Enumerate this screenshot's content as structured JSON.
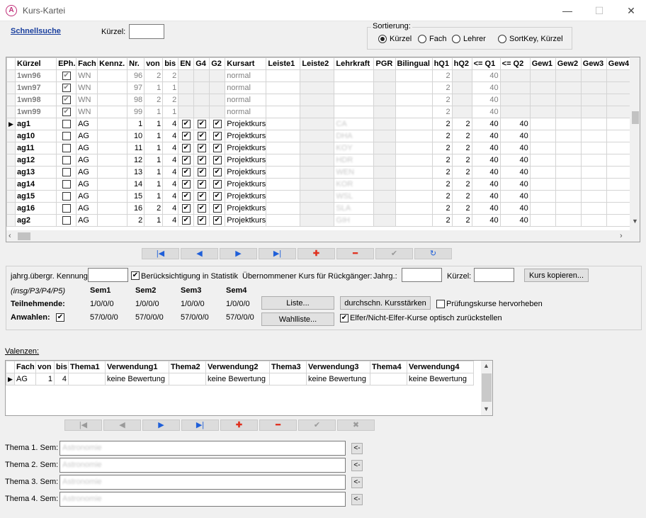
{
  "window": {
    "title": "Kurs-Kartei",
    "minimize": "—",
    "maximize": "☐",
    "close": "✕"
  },
  "quicksearch": {
    "link": "Schnellsuche",
    "kuerzel_label": "Kürzel:",
    "kuerzel_value": ""
  },
  "sort": {
    "title": "Sortierung:",
    "options": [
      "Kürzel",
      "Fach",
      "Lehrer",
      "SortKey, Kürzel"
    ],
    "selected": 0
  },
  "grid": {
    "columns": [
      "Kürzel",
      "EPh.",
      "Fach",
      "Kennz.",
      "Nr.",
      "von",
      "bis",
      "EN",
      "G4",
      "G2",
      "Kursart",
      "Leiste1",
      "Leiste2",
      "Lehrkraft",
      "PGR",
      "Bilingual",
      "hQ1",
      "hQ2",
      "<= Q1",
      "<= Q2",
      "Gew1",
      "Gew2",
      "Gew3",
      "Gew4"
    ],
    "rows": [
      {
        "k": "1wn96",
        "eph": true,
        "fach": "WN",
        "nr": "96",
        "von": "2",
        "bis": "2",
        "en": false,
        "g4": false,
        "g2": false,
        "art": "normal",
        "lk": "",
        "hq1": "2",
        "hq2": "",
        "q1": "40",
        "q2": "",
        "grey": true
      },
      {
        "k": "1wn97",
        "eph": true,
        "fach": "WN",
        "nr": "97",
        "von": "1",
        "bis": "1",
        "en": false,
        "g4": false,
        "g2": false,
        "art": "normal",
        "lk": "",
        "hq1": "2",
        "hq2": "",
        "q1": "40",
        "q2": "",
        "grey": true
      },
      {
        "k": "1wn98",
        "eph": true,
        "fach": "WN",
        "nr": "98",
        "von": "2",
        "bis": "2",
        "en": false,
        "g4": false,
        "g2": false,
        "art": "normal",
        "lk": "",
        "hq1": "2",
        "hq2": "",
        "q1": "40",
        "q2": "",
        "grey": true
      },
      {
        "k": "1wn99",
        "eph": true,
        "fach": "WN",
        "nr": "99",
        "von": "1",
        "bis": "1",
        "en": false,
        "g4": false,
        "g2": false,
        "art": "normal",
        "lk": "",
        "hq1": "2",
        "hq2": "",
        "q1": "40",
        "q2": "",
        "grey": true
      },
      {
        "k": "ag1",
        "eph": false,
        "fach": "AG",
        "nr": "1",
        "von": "1",
        "bis": "4",
        "en": true,
        "g4": true,
        "g2": true,
        "art": "Projektkurs",
        "lk": "CA",
        "hq1": "2",
        "hq2": "2",
        "q1": "40",
        "q2": "40",
        "grey": false,
        "current": true
      },
      {
        "k": "ag10",
        "eph": false,
        "fach": "AG",
        "nr": "10",
        "von": "1",
        "bis": "4",
        "en": true,
        "g4": true,
        "g2": true,
        "art": "Projektkurs",
        "lk": "DHA",
        "hq1": "2",
        "hq2": "2",
        "q1": "40",
        "q2": "40",
        "grey": false
      },
      {
        "k": "ag11",
        "eph": false,
        "fach": "AG",
        "nr": "11",
        "von": "1",
        "bis": "4",
        "en": true,
        "g4": true,
        "g2": true,
        "art": "Projektkurs",
        "lk": "KOY",
        "hq1": "2",
        "hq2": "2",
        "q1": "40",
        "q2": "40",
        "grey": false
      },
      {
        "k": "ag12",
        "eph": false,
        "fach": "AG",
        "nr": "12",
        "von": "1",
        "bis": "4",
        "en": true,
        "g4": true,
        "g2": true,
        "art": "Projektkurs",
        "lk": "HDR",
        "hq1": "2",
        "hq2": "2",
        "q1": "40",
        "q2": "40",
        "grey": false
      },
      {
        "k": "ag13",
        "eph": false,
        "fach": "AG",
        "nr": "13",
        "von": "1",
        "bis": "4",
        "en": true,
        "g4": true,
        "g2": true,
        "art": "Projektkurs",
        "lk": "WEN",
        "hq1": "2",
        "hq2": "2",
        "q1": "40",
        "q2": "40",
        "grey": false
      },
      {
        "k": "ag14",
        "eph": false,
        "fach": "AG",
        "nr": "14",
        "von": "1",
        "bis": "4",
        "en": true,
        "g4": true,
        "g2": true,
        "art": "Projektkurs",
        "lk": "KOR",
        "hq1": "2",
        "hq2": "2",
        "q1": "40",
        "q2": "40",
        "grey": false
      },
      {
        "k": "ag15",
        "eph": false,
        "fach": "AG",
        "nr": "15",
        "von": "1",
        "bis": "4",
        "en": true,
        "g4": true,
        "g2": true,
        "art": "Projektkurs",
        "lk": "WSL",
        "hq1": "2",
        "hq2": "2",
        "q1": "40",
        "q2": "40",
        "grey": false
      },
      {
        "k": "ag16",
        "eph": false,
        "fach": "AG",
        "nr": "16",
        "von": "2",
        "bis": "4",
        "en": true,
        "g4": true,
        "g2": true,
        "art": "Projektkurs",
        "lk": "SLA",
        "hq1": "2",
        "hq2": "2",
        "q1": "40",
        "q2": "40",
        "grey": false
      },
      {
        "k": "ag2",
        "eph": false,
        "fach": "AG",
        "nr": "2",
        "von": "1",
        "bis": "4",
        "en": true,
        "g4": true,
        "g2": true,
        "art": "Projektkurs",
        "lk": "GIH",
        "hq1": "2",
        "hq2": "2",
        "q1": "40",
        "q2": "40",
        "grey": false
      }
    ]
  },
  "navbar1": [
    "|◀",
    "◀",
    "▶",
    "▶|",
    "✚",
    "━",
    "✔",
    "↻"
  ],
  "details": {
    "kennung_label": "jahrg.übergr. Kennung",
    "statistik_label": "Berücksichtigung in Statistik",
    "uebernommen_label": "Übernommener Kurs für Rückgänger:",
    "jahrg_label": "Jahrg.:",
    "kuerzel_label": "Kürzel:",
    "kopieren_button": "Kurs kopieren...",
    "insg_label": "(insg/P3/P4/P5)",
    "sem_headers": [
      "Sem1",
      "Sem2",
      "Sem3",
      "Sem4"
    ],
    "teilnehmende_label": "Teilnehmende:",
    "teilnehmende_values": [
      "1/0/0/0",
      "1/0/0/0",
      "1/0/0/0",
      "1/0/0/0"
    ],
    "anwahlen_label": "Anwahlen:",
    "anwahlen_values": [
      "57/0/0/0",
      "57/0/0/0",
      "57/0/0/0",
      "57/0/0/0"
    ],
    "liste_button": "Liste...",
    "wahlliste_button": "Wahlliste...",
    "kursstaerken_button": "durchschn. Kursstärken",
    "pruefung_label": "Prüfungskurse hervorheben",
    "elfer_label": "Elfer/Nicht-Elfer-Kurse optisch zurückstellen"
  },
  "valenzen": {
    "title": "Valenzen:",
    "columns": [
      "Fach",
      "von",
      "bis",
      "Thema1",
      "Verwendung1",
      "Thema2",
      "Verwendung2",
      "Thema3",
      "Verwendung3",
      "Thema4",
      "Verwendung4"
    ],
    "row": [
      "AG",
      "1",
      "4",
      "",
      "keine Bewertung",
      "",
      "keine Bewertung",
      "",
      "keine Bewertung",
      "",
      "keine Bewertung"
    ]
  },
  "navbar2": [
    "|◀",
    "◀",
    "▶",
    "▶|",
    "✚",
    "━",
    "✔",
    "✖"
  ],
  "themen": [
    {
      "label": "Thema 1. Sem:",
      "value": "Astronomie",
      "btn": "<-"
    },
    {
      "label": "Thema 2. Sem:",
      "value": "Astronomie",
      "btn": "<-"
    },
    {
      "label": "Thema 3. Sem:",
      "value": "Astronomie",
      "btn": "<-"
    },
    {
      "label": "Thema 4. Sem:",
      "value": "Astronomie",
      "btn": "<-"
    }
  ]
}
